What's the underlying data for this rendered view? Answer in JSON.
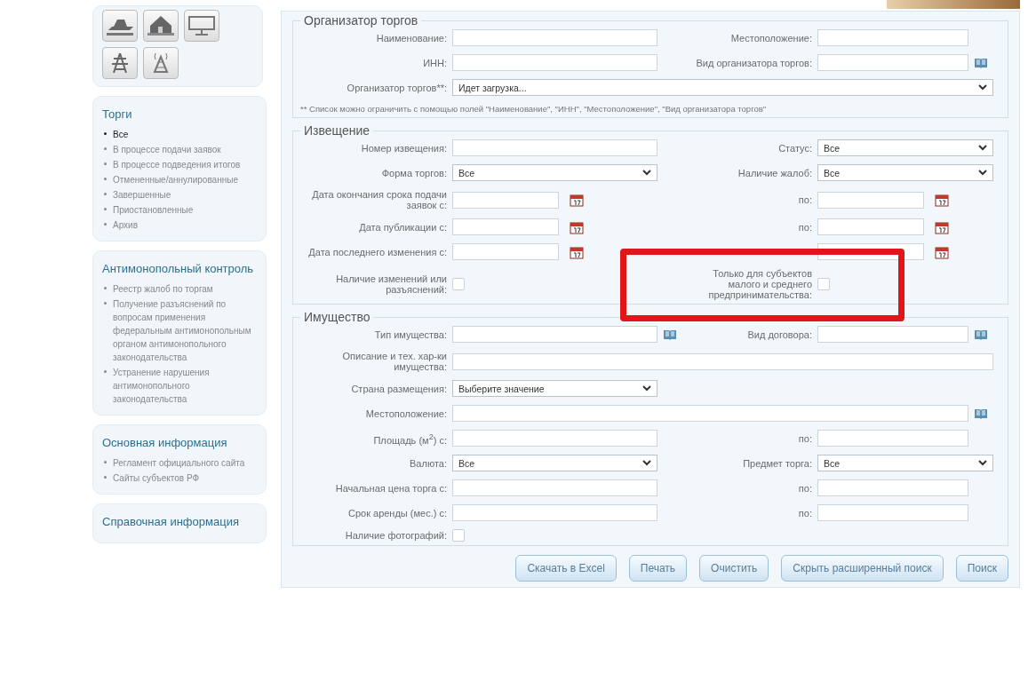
{
  "sidebar": {
    "sections": [
      {
        "title": "Торги",
        "items": [
          {
            "label": "Все",
            "selected": true
          },
          {
            "label": "В процессе подачи заявок",
            "selected": false
          },
          {
            "label": "В процессе подведения итогов",
            "selected": false
          },
          {
            "label": "Отмененные/аннулированные",
            "selected": false
          },
          {
            "label": "Завершенные",
            "selected": false
          },
          {
            "label": "Приостановленные",
            "selected": false
          },
          {
            "label": "Архив",
            "selected": false
          }
        ]
      },
      {
        "title": "Антимонопольный контроль",
        "items": [
          {
            "label": "Реестр жалоб по торгам",
            "selected": false
          },
          {
            "label": "Получение разъяснений по вопросам применения федеральным антимонопольным органом антимонопольного законодательства",
            "selected": false
          },
          {
            "label": "Устранение нарушения антимонопольного законодательства",
            "selected": false
          }
        ]
      },
      {
        "title": "Основная информация",
        "items": [
          {
            "label": "Регламент официального сайта",
            "selected": false
          },
          {
            "label": "Сайты субъектов РФ",
            "selected": false
          }
        ]
      },
      {
        "title": "Справочная информация"
      }
    ]
  },
  "form": {
    "fieldsets": [
      {
        "legend": "Организатор торгов",
        "rows": [
          {
            "kind": "pair",
            "left": {
              "label": "Наименование:",
              "kind": "text"
            },
            "right": {
              "label": "Местоположение:",
              "kind": "text"
            }
          },
          {
            "kind": "pair",
            "left": {
              "label": "ИНН:",
              "kind": "text"
            },
            "right": {
              "label": "Вид организатора торгов:",
              "kind": "text",
              "book": true
            }
          },
          {
            "kind": "full",
            "field": {
              "label": "Организатор торгов**:",
              "kind": "select",
              "value": "Идет загрузка..."
            }
          },
          {
            "kind": "note",
            "text": "** Список можно ограничить с помощью полей \"Наименование\", \"ИНН\", \"Местоположение\", \"Вид организатора торгов\""
          }
        ]
      },
      {
        "legend": "Извещение",
        "rows": [
          {
            "kind": "pair",
            "left": {
              "label": "Номер извещения:",
              "kind": "text"
            },
            "right": {
              "label": "Статус:",
              "kind": "select",
              "value": "Все"
            }
          },
          {
            "kind": "pair",
            "left": {
              "label": "Форма торгов:",
              "kind": "select",
              "value": "Все"
            },
            "right": {
              "label": "Наличие жалоб:",
              "kind": "select",
              "value": "Все"
            }
          },
          {
            "kind": "pair",
            "left": {
              "label": "Дата окончания срока подачи заявок с:",
              "kind": "date"
            },
            "right": {
              "label": "по:",
              "kind": "date"
            }
          },
          {
            "kind": "pair",
            "left": {
              "label": "Дата публикации с:",
              "kind": "date"
            },
            "right": {
              "label": "по:",
              "kind": "date"
            }
          },
          {
            "kind": "pair",
            "left": {
              "label": "Дата последнего изменения с:",
              "kind": "date"
            },
            "right": {
              "kind": "date"
            }
          },
          {
            "kind": "pair",
            "left": {
              "label": "Наличие изменений или разъяснений:",
              "kind": "checkbox",
              "checked": false
            },
            "right": {
              "label": "Только для субъектов малого и среднего предпринимательства:",
              "kind": "checkbox",
              "checked": false,
              "highlighted": true
            }
          }
        ]
      },
      {
        "legend": "Имущество",
        "rows": [
          {
            "kind": "pair",
            "left": {
              "label": "Тип имущества:",
              "kind": "text",
              "book": true
            },
            "right": {
              "label": "Вид договора:",
              "kind": "text",
              "book": true
            }
          },
          {
            "kind": "full",
            "field": {
              "label": "Описание и тех. хар-ки имущества:",
              "kind": "text"
            }
          },
          {
            "kind": "pair",
            "left": {
              "label": "Страна размещения:",
              "kind": "select",
              "value": "Выберите значение"
            }
          },
          {
            "kind": "full",
            "field": {
              "label": "Местоположение:",
              "kind": "text",
              "book": true
            }
          },
          {
            "kind": "pair",
            "left": {
              "label": "Площадь (м$^{2}$) с:",
              "kind": "text"
            },
            "right": {
              "label": "по:",
              "kind": "text"
            }
          },
          {
            "kind": "pair",
            "left": {
              "label": "Валюта:",
              "kind": "select",
              "value": "Все"
            },
            "right": {
              "label": "Предмет торга:",
              "kind": "select",
              "value": "Все"
            }
          },
          {
            "kind": "pair",
            "left": {
              "label": "Начальная цена торга с:",
              "kind": "text"
            },
            "right": {
              "label": "по:",
              "kind": "text"
            }
          },
          {
            "kind": "pair",
            "left": {
              "label": "Срок аренды (мес.) с:",
              "kind": "text"
            },
            "right": {
              "label": "по:",
              "kind": "text"
            }
          },
          {
            "kind": "pair",
            "left": {
              "label": "Наличие фотографий:",
              "kind": "checkbox",
              "checked": false
            }
          }
        ]
      }
    ],
    "buttons": [
      "Скачать в Excel",
      "Печать",
      "Очистить",
      "Скрыть расширенный поиск",
      "Поиск"
    ]
  }
}
